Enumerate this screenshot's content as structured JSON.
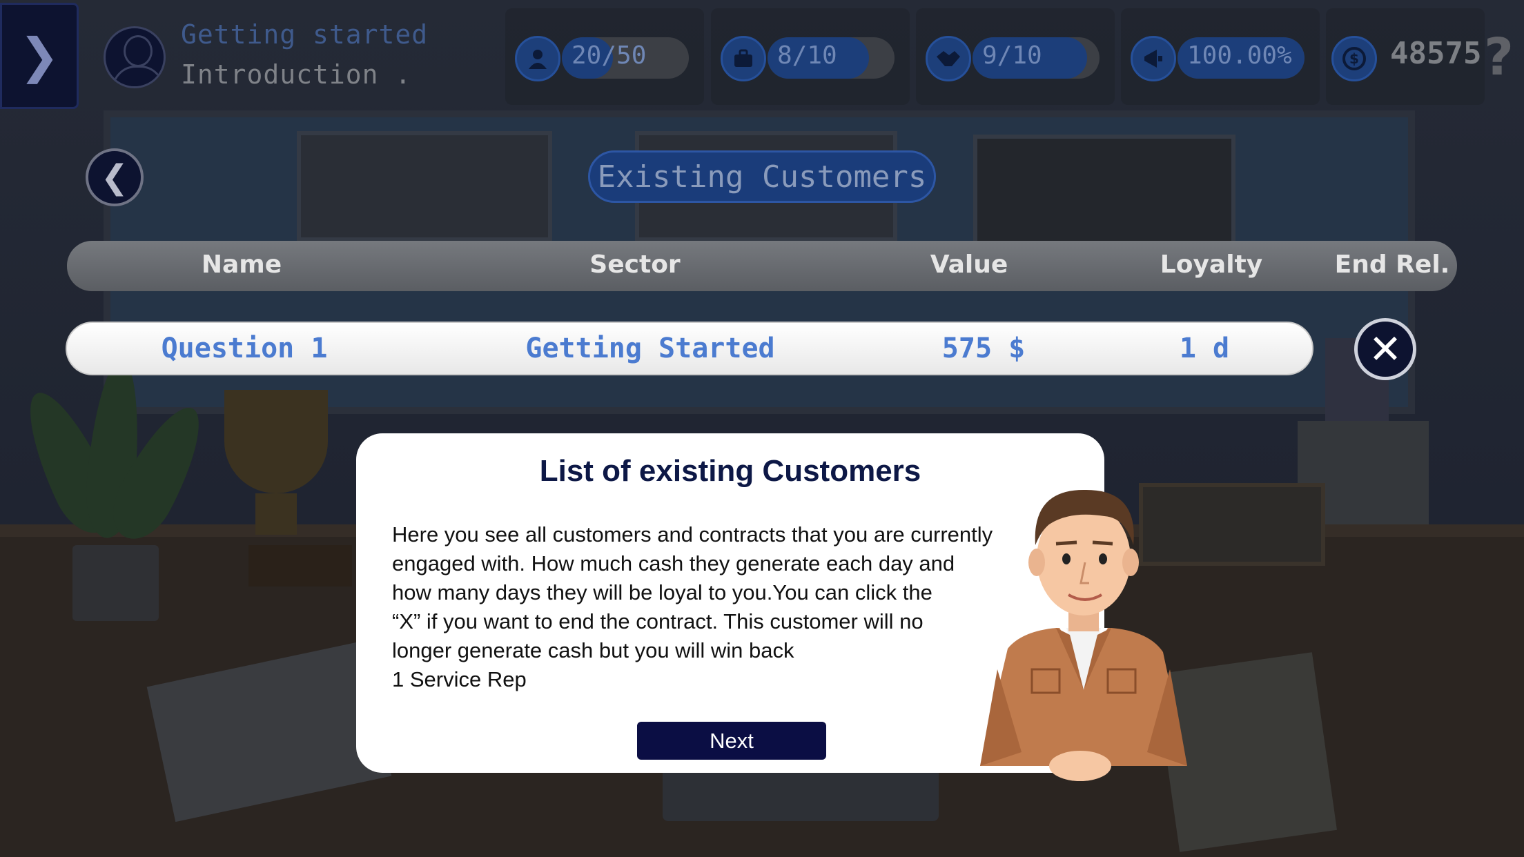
{
  "hud": {
    "level_title": "Getting started",
    "level_subtitle": "Introduction .",
    "stats": [
      {
        "name": "employees",
        "icon": "person-icon",
        "label": "20/50",
        "fill": 0.4
      },
      {
        "name": "projects",
        "icon": "briefcase-icon",
        "label": "8/10",
        "fill": 0.8
      },
      {
        "name": "customers",
        "icon": "handshake-icon",
        "label": "9/10",
        "fill": 0.9
      },
      {
        "name": "marketing",
        "icon": "megaphone-icon",
        "label": "100.00%",
        "fill": 1.0
      }
    ],
    "money": "48575",
    "help_label": "?"
  },
  "screen": {
    "title": "Existing Customers",
    "columns": {
      "name": "Name",
      "sector": "Sector",
      "value": "Value",
      "loyalty": "Loyalty",
      "end": "End Rel."
    },
    "rows": [
      {
        "name": "Question 1",
        "sector": "Getting Started",
        "value": "575 $",
        "loyalty": "1 d"
      }
    ]
  },
  "tutorial": {
    "title": "List of existing Customers",
    "body_lines": [
      "Here you see all customers and contracts that you are currently",
      "engaged with. How much cash they generate each day and",
      "how many days they will be loyal to you.You can click the",
      "“X” if you want to end the contract. This customer will no",
      "longer generate cash but you will win back",
      "1 Service Rep"
    ],
    "next_label": "Next"
  },
  "colors": {
    "accent_blue": "#4b7bd0",
    "dark_navy": "#0d1330",
    "button_navy": "#0b0e44"
  }
}
